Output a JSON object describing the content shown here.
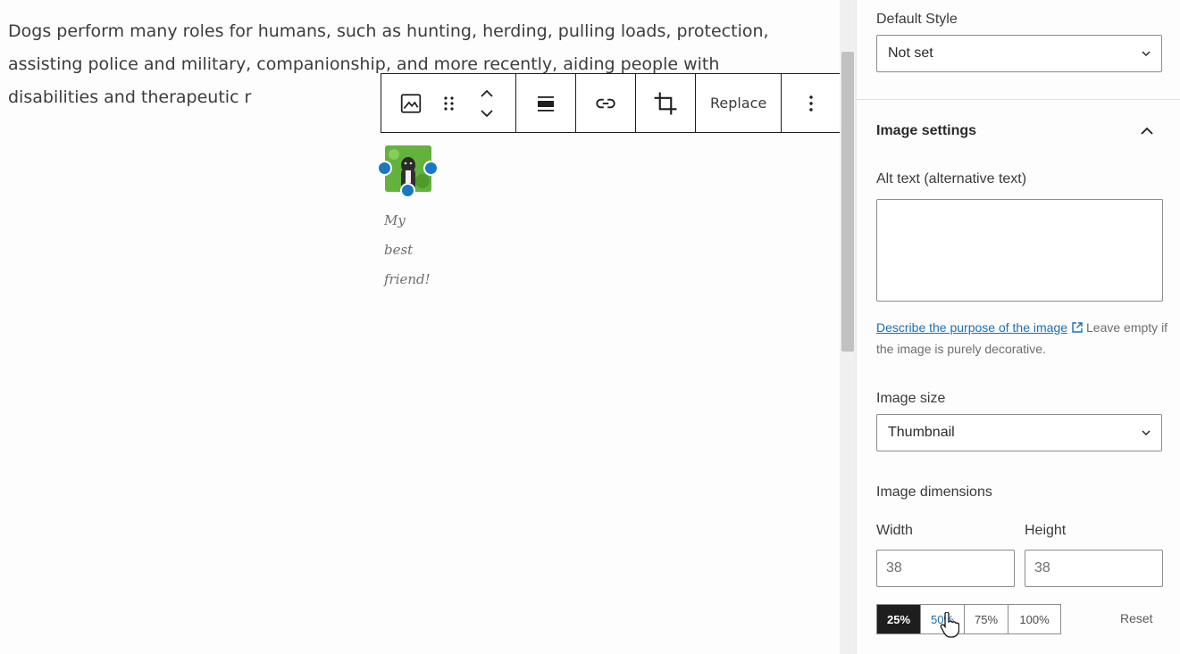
{
  "editor": {
    "paragraph": "Dogs perform many roles for humans, such as hunting, herding, pulling loads, protection, assisting police and military, companionship, and more recently, aiding people with disabilities and therapeutic r",
    "toolbar": {
      "image_icon": "image-icon",
      "drag_icon": "drag-handle-icon",
      "move_icon": "move-up-down-icon",
      "align_icon": "align-icon",
      "link_icon": "link-icon",
      "crop_icon": "crop-icon",
      "replace_label": "Replace",
      "more_icon": "more-vertical-icon"
    },
    "caption": [
      "My",
      "best",
      "friend!"
    ]
  },
  "sidebar": {
    "default_style": {
      "label": "Default Style",
      "value": "Not set"
    },
    "image_settings": {
      "title": "Image settings",
      "alt_label": "Alt text (alternative text)",
      "alt_value": "",
      "help_link": "Describe the purpose of the image",
      "help_text": "Leave empty if the image is purely decorative.",
      "size_label": "Image size",
      "size_value": "Thumbnail",
      "dimensions_label": "Image dimensions",
      "width_label": "Width",
      "width_value": "38",
      "height_label": "Height",
      "height_value": "38",
      "percent_buttons": [
        "25%",
        "50%",
        "75%",
        "100%"
      ],
      "active_percent": "25%",
      "reset_label": "Reset"
    }
  },
  "colors": {
    "accent": "#1a78c2",
    "link": "#1a6fb5",
    "active_button": "#1e1e1e"
  }
}
